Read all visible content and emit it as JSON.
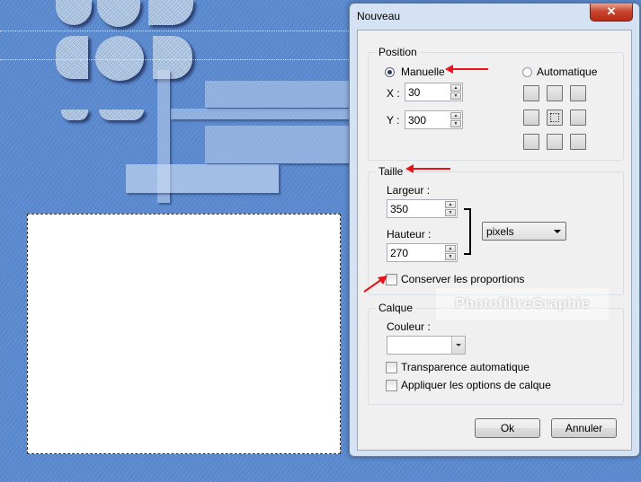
{
  "dialog": {
    "title": "Nouveau",
    "close_glyph": "✕"
  },
  "position": {
    "legend": "Position",
    "manual_label": "Manuelle",
    "auto_label": "Automatique",
    "mode_selected": "Manuelle",
    "x_label": "X :",
    "x_value": "30",
    "y_label": "Y :",
    "y_value": "300",
    "grid_selected_index": 4
  },
  "size": {
    "legend": "Taille",
    "width_label": "Largeur :",
    "width_value": "350",
    "height_label": "Hauteur :",
    "height_value": "270",
    "unit_value": "pixels",
    "keep_ratio_label": "Conserver les proportions",
    "keep_ratio_checked": false
  },
  "layer": {
    "legend": "Calque",
    "color_label": "Couleur :",
    "color_value": "#ffffff",
    "auto_transparency_label": "Transparence automatique",
    "auto_transparency_checked": false,
    "apply_options_label": "Appliquer les options de calque",
    "apply_options_checked": false
  },
  "buttons": {
    "ok": "Ok",
    "cancel": "Annuler"
  },
  "watermark": "PhotofiltreGraphie",
  "colors": {
    "annotation_arrow": "#e8141c",
    "background_blue": "#5a8ad0",
    "dialog_frame": "#d4e2f3"
  }
}
